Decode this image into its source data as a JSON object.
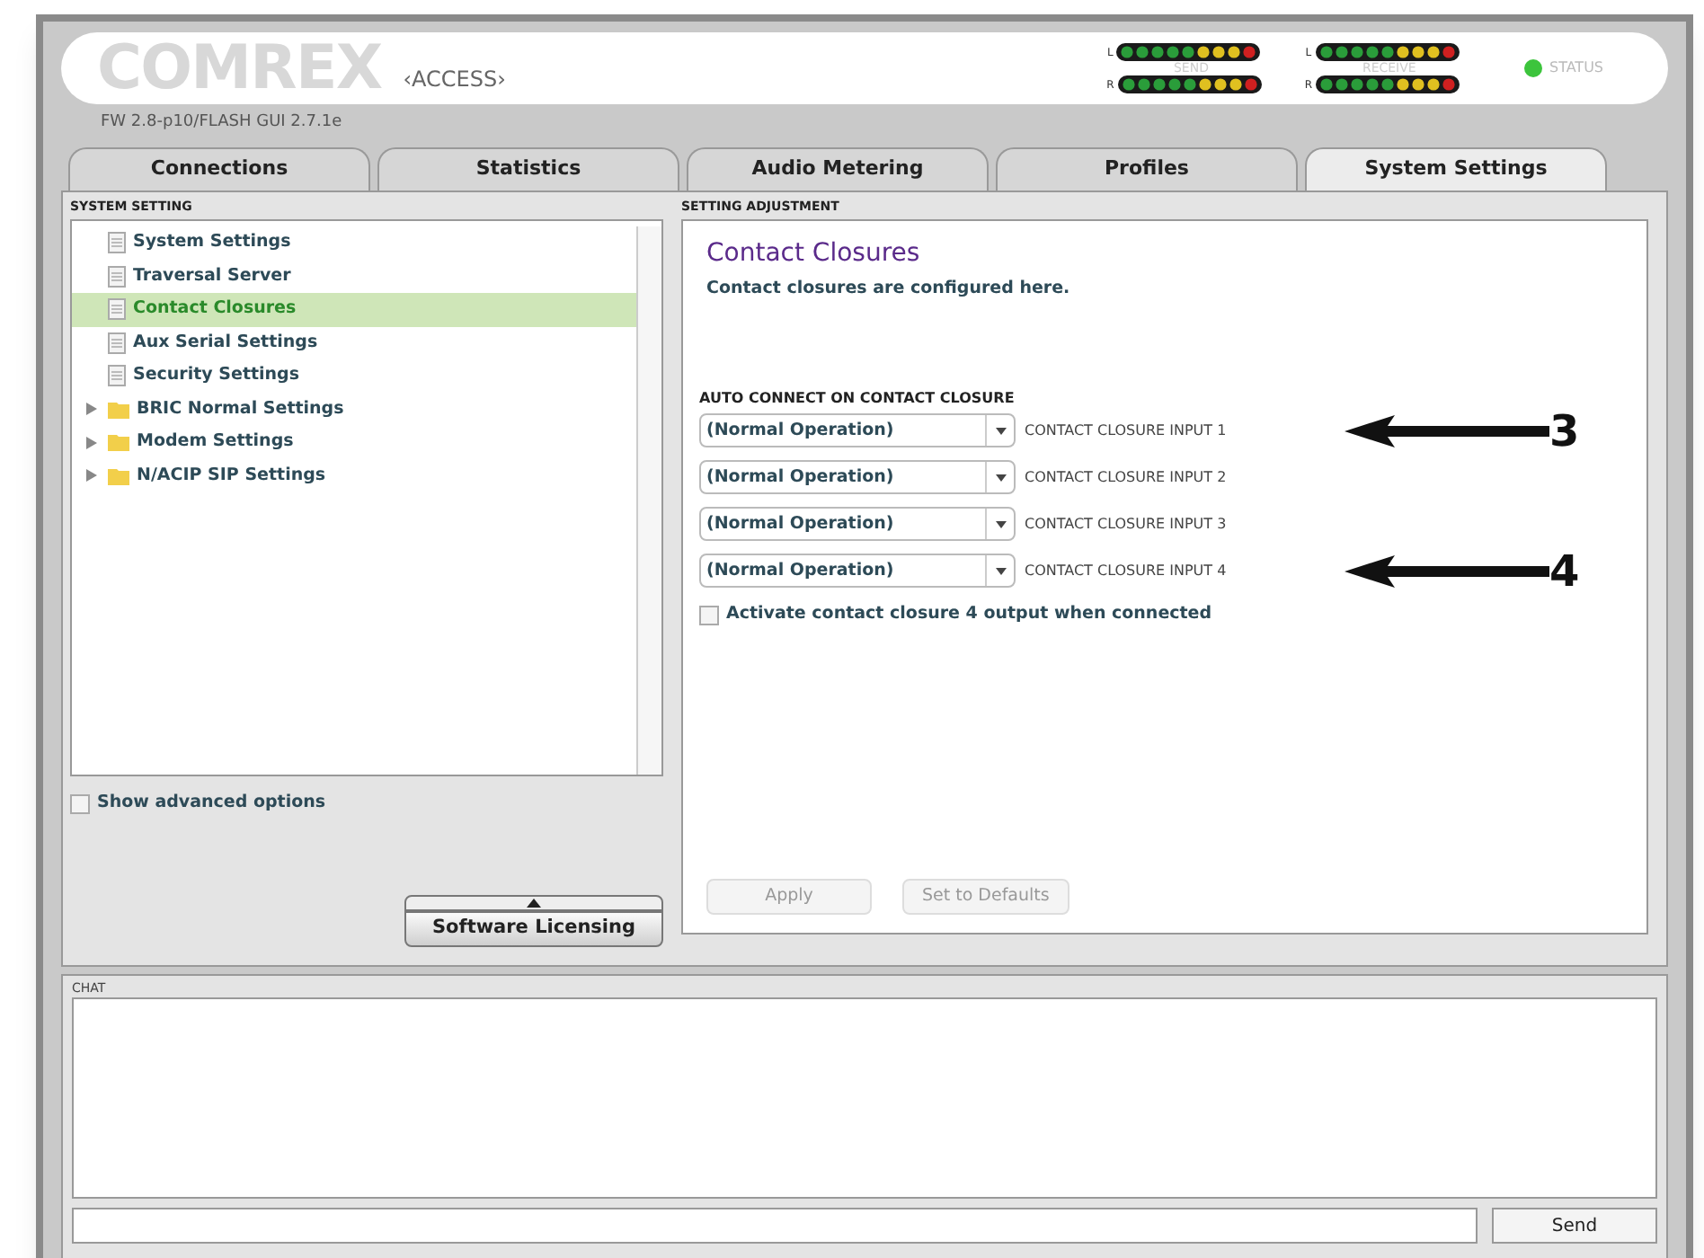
{
  "header": {
    "logo": "COMREX",
    "product": "‹ACCESS›",
    "firmware": "FW 2.8-p10/FLASH GUI 2.7.1e",
    "meters": [
      {
        "label": "SEND",
        "channels": [
          "L",
          "R"
        ]
      },
      {
        "label": "RECEIVE",
        "channels": [
          "L",
          "R"
        ]
      }
    ],
    "status": {
      "label": "STATUS",
      "on": true
    }
  },
  "tabs": [
    {
      "label": "Connections",
      "selected": false
    },
    {
      "label": "Statistics",
      "selected": false
    },
    {
      "label": "Audio Metering",
      "selected": false
    },
    {
      "label": "Profiles",
      "selected": false
    },
    {
      "label": "System Settings",
      "selected": true
    }
  ],
  "sidebar": {
    "title": "SYSTEM SETTING",
    "items": [
      {
        "kind": "page",
        "label": "System Settings",
        "selected": false
      },
      {
        "kind": "page",
        "label": "Traversal Server",
        "selected": false
      },
      {
        "kind": "page",
        "label": "Contact Closures",
        "selected": true
      },
      {
        "kind": "page",
        "label": "Aux Serial Settings",
        "selected": false
      },
      {
        "kind": "page",
        "label": "Security Settings",
        "selected": false
      },
      {
        "kind": "folder",
        "label": "BRIC Normal Settings",
        "selected": false,
        "expanded": false
      },
      {
        "kind": "folder",
        "label": "Modem Settings",
        "selected": false,
        "expanded": false
      },
      {
        "kind": "folder",
        "label": "N/ACIP SIP Settings",
        "selected": false,
        "expanded": false
      }
    ],
    "advanced": {
      "label": "Show advanced options",
      "checked": false
    },
    "licensing_button": "Software Licensing"
  },
  "settings": {
    "title": "SETTING ADJUSTMENT",
    "heading": "Contact Closures",
    "description": "Contact closures are configured here.",
    "section": "AUTO CONNECT ON CONTACT CLOSURE",
    "closures": [
      {
        "value": "(Normal Operation)",
        "label": "CONTACT CLOSURE INPUT 1",
        "callout": "3"
      },
      {
        "value": "(Normal Operation)",
        "label": "CONTACT CLOSURE INPUT 2"
      },
      {
        "value": "(Normal Operation)",
        "label": "CONTACT CLOSURE INPUT 3"
      },
      {
        "value": "(Normal Operation)",
        "label": "CONTACT CLOSURE INPUT 4",
        "callout": "4"
      }
    ],
    "output_option": {
      "label": "Activate contact closure 4 output when connected",
      "checked": false
    },
    "buttons": [
      {
        "label": "Apply",
        "disabled": true
      },
      {
        "label": "Set to Defaults",
        "disabled": true
      }
    ]
  },
  "chat": {
    "title": "CHAT",
    "send": "Send"
  }
}
